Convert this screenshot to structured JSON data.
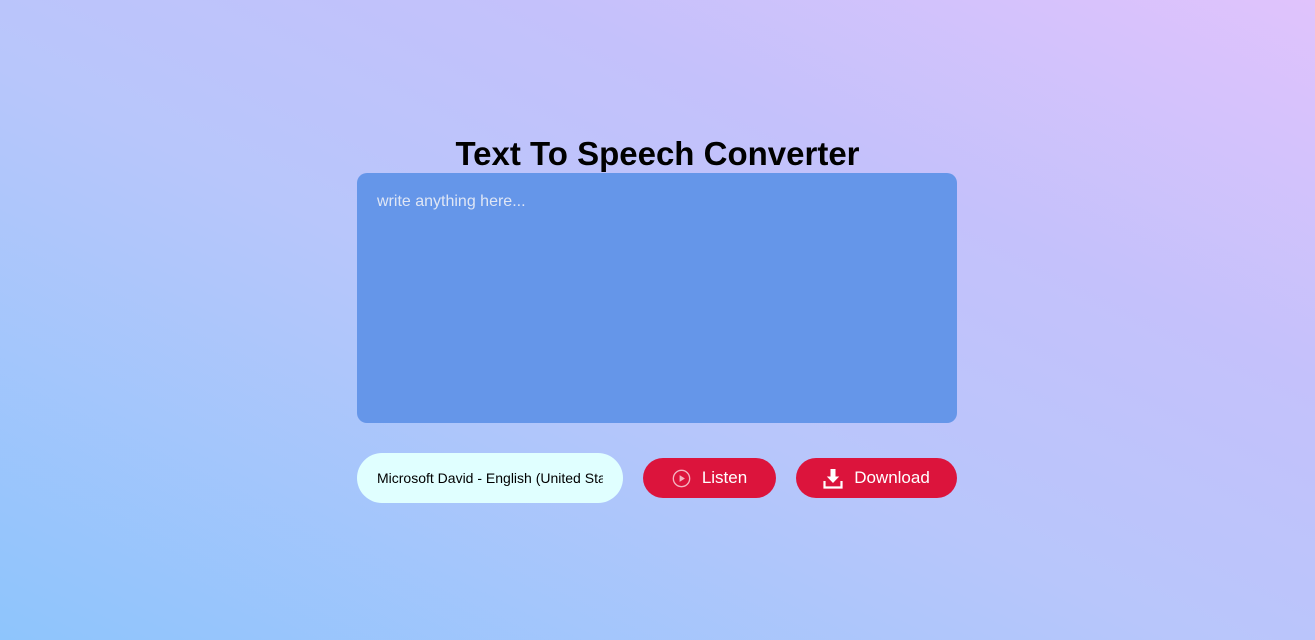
{
  "header": {
    "title": "Text To Speech Converter"
  },
  "editor": {
    "placeholder": "write anything here...",
    "value": ""
  },
  "controls": {
    "voice_selected": "Microsoft David - English (United States)",
    "listen_label": "Listen",
    "listen_icon": "play-circle-icon",
    "download_label": "Download",
    "download_icon": "download-icon"
  },
  "colors": {
    "background_start": "#8ec5fc",
    "background_end": "#e0c3fc",
    "textarea_bg": "#6596e9",
    "select_bg": "#e0ffff",
    "button_bg": "#dc143c",
    "button_text": "#ffffff"
  }
}
